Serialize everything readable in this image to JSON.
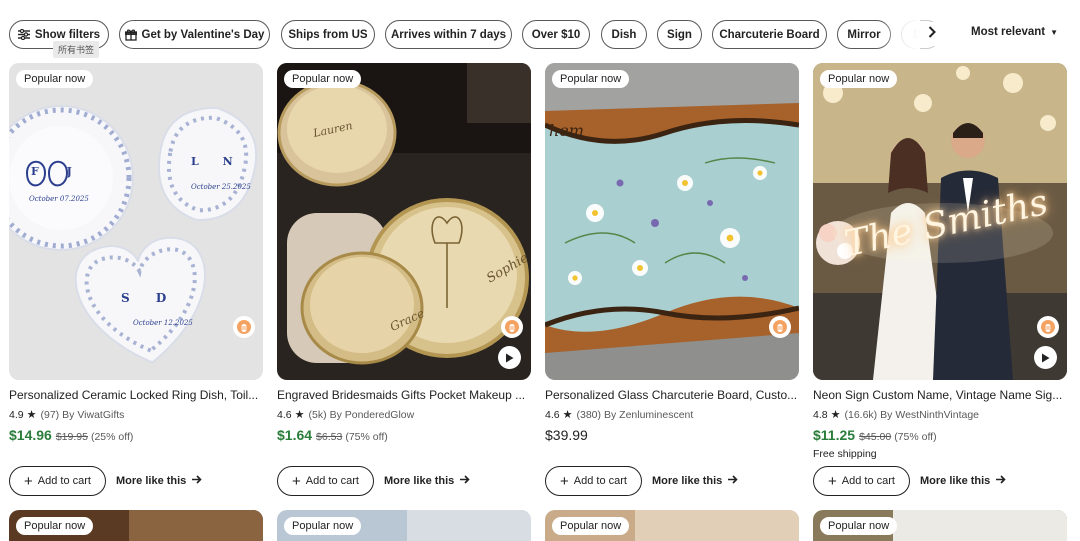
{
  "filters": {
    "show_filters": "Show filters",
    "chips": [
      "Get by Valentine's Day",
      "Ships from US",
      "Arrives within 7 days",
      "Over $10",
      "Dish",
      "Sign",
      "Charcuterie Board",
      "Mirror"
    ],
    "partial_chip": "B",
    "tooltip": "所有书签",
    "sort_label": "Most relevant"
  },
  "badge_text": "Popular now",
  "add_to_cart": "Add to cart",
  "more_like_this": "More like this",
  "listings": [
    {
      "title": "Personalized Ceramic Locked Ring Dish, Toil...",
      "rating": "4.9",
      "reviews": "(97)",
      "shop": "By ViwatGifts",
      "price": "$14.96",
      "original_price": "$19.95",
      "discount": "(25% off)",
      "shipping": "",
      "has_video": false
    },
    {
      "title": "Engraved Bridesmaids Gifts Pocket Makeup ...",
      "rating": "4.6",
      "reviews": "(5k)",
      "shop": "By PonderedGlow",
      "price": "$1.64",
      "original_price": "$6.53",
      "discount": "(75% off)",
      "shipping": "",
      "has_video": true
    },
    {
      "title": "Personalized Glass Charcuterie Board, Custo...",
      "rating": "4.6",
      "reviews": "(380)",
      "shop": "By Zenluminescent",
      "price": "$39.99",
      "original_price": "",
      "discount": "",
      "shipping": "",
      "has_video": false
    },
    {
      "title": "Neon Sign Custom Name, Vintage Name Sig...",
      "rating": "4.8",
      "reviews": "(16.6k)",
      "shop": "By WestNinthVintage",
      "price": "$11.25",
      "original_price": "$45.00",
      "discount": "(75% off)",
      "shipping": "Free shipping",
      "has_video": true
    }
  ],
  "image_text": {
    "dish_initials_1": "F J",
    "dish_date_1": "October 07.2025",
    "dish_initials_2": "L N",
    "dish_date_2": "October 25.2025",
    "dish_initials_3": "S D",
    "dish_date_3": "October 12.2025",
    "mirror_name_1": "Lauren",
    "mirror_name_2": "Sophie",
    "mirror_name_3": "Grace",
    "board_initial": "hem",
    "neon_text": "The Smiths"
  },
  "colors": {
    "sale_price": "#2a7d3a",
    "neon": "#fff5e0"
  }
}
